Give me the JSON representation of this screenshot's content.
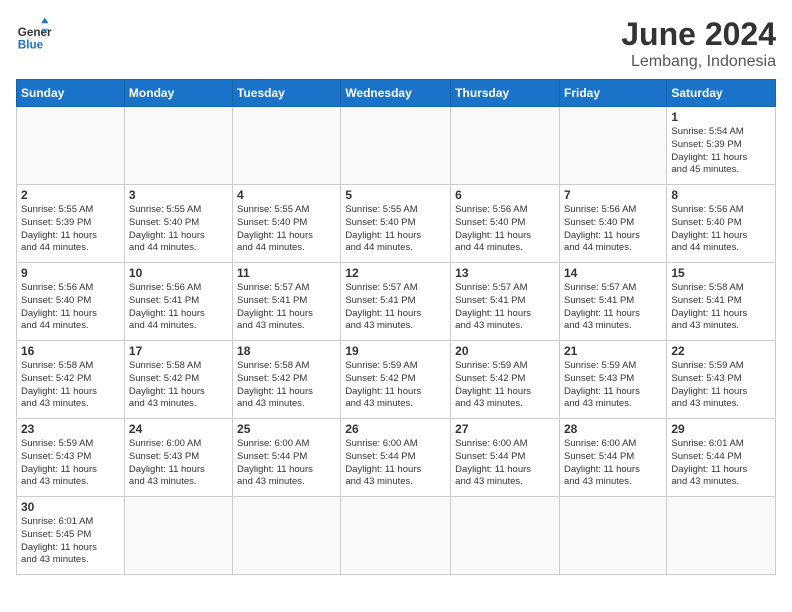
{
  "logo": {
    "text_general": "General",
    "text_blue": "Blue"
  },
  "title": "June 2024",
  "subtitle": "Lembang, Indonesia",
  "days_of_week": [
    "Sunday",
    "Monday",
    "Tuesday",
    "Wednesday",
    "Thursday",
    "Friday",
    "Saturday"
  ],
  "weeks": [
    [
      {
        "day": "",
        "info": ""
      },
      {
        "day": "",
        "info": ""
      },
      {
        "day": "",
        "info": ""
      },
      {
        "day": "",
        "info": ""
      },
      {
        "day": "",
        "info": ""
      },
      {
        "day": "",
        "info": ""
      },
      {
        "day": "1",
        "info": "Sunrise: 5:54 AM\nSunset: 5:39 PM\nDaylight: 11 hours\nand 45 minutes."
      }
    ],
    [
      {
        "day": "2",
        "info": "Sunrise: 5:55 AM\nSunset: 5:39 PM\nDaylight: 11 hours\nand 44 minutes."
      },
      {
        "day": "3",
        "info": "Sunrise: 5:55 AM\nSunset: 5:40 PM\nDaylight: 11 hours\nand 44 minutes."
      },
      {
        "day": "4",
        "info": "Sunrise: 5:55 AM\nSunset: 5:40 PM\nDaylight: 11 hours\nand 44 minutes."
      },
      {
        "day": "5",
        "info": "Sunrise: 5:55 AM\nSunset: 5:40 PM\nDaylight: 11 hours\nand 44 minutes."
      },
      {
        "day": "6",
        "info": "Sunrise: 5:56 AM\nSunset: 5:40 PM\nDaylight: 11 hours\nand 44 minutes."
      },
      {
        "day": "7",
        "info": "Sunrise: 5:56 AM\nSunset: 5:40 PM\nDaylight: 11 hours\nand 44 minutes."
      },
      {
        "day": "8",
        "info": "Sunrise: 5:56 AM\nSunset: 5:40 PM\nDaylight: 11 hours\nand 44 minutes."
      }
    ],
    [
      {
        "day": "9",
        "info": "Sunrise: 5:56 AM\nSunset: 5:40 PM\nDaylight: 11 hours\nand 44 minutes."
      },
      {
        "day": "10",
        "info": "Sunrise: 5:56 AM\nSunset: 5:41 PM\nDaylight: 11 hours\nand 44 minutes."
      },
      {
        "day": "11",
        "info": "Sunrise: 5:57 AM\nSunset: 5:41 PM\nDaylight: 11 hours\nand 43 minutes."
      },
      {
        "day": "12",
        "info": "Sunrise: 5:57 AM\nSunset: 5:41 PM\nDaylight: 11 hours\nand 43 minutes."
      },
      {
        "day": "13",
        "info": "Sunrise: 5:57 AM\nSunset: 5:41 PM\nDaylight: 11 hours\nand 43 minutes."
      },
      {
        "day": "14",
        "info": "Sunrise: 5:57 AM\nSunset: 5:41 PM\nDaylight: 11 hours\nand 43 minutes."
      },
      {
        "day": "15",
        "info": "Sunrise: 5:58 AM\nSunset: 5:41 PM\nDaylight: 11 hours\nand 43 minutes."
      }
    ],
    [
      {
        "day": "16",
        "info": "Sunrise: 5:58 AM\nSunset: 5:42 PM\nDaylight: 11 hours\nand 43 minutes."
      },
      {
        "day": "17",
        "info": "Sunrise: 5:58 AM\nSunset: 5:42 PM\nDaylight: 11 hours\nand 43 minutes."
      },
      {
        "day": "18",
        "info": "Sunrise: 5:58 AM\nSunset: 5:42 PM\nDaylight: 11 hours\nand 43 minutes."
      },
      {
        "day": "19",
        "info": "Sunrise: 5:59 AM\nSunset: 5:42 PM\nDaylight: 11 hours\nand 43 minutes."
      },
      {
        "day": "20",
        "info": "Sunrise: 5:59 AM\nSunset: 5:42 PM\nDaylight: 11 hours\nand 43 minutes."
      },
      {
        "day": "21",
        "info": "Sunrise: 5:59 AM\nSunset: 5:43 PM\nDaylight: 11 hours\nand 43 minutes."
      },
      {
        "day": "22",
        "info": "Sunrise: 5:59 AM\nSunset: 5:43 PM\nDaylight: 11 hours\nand 43 minutes."
      }
    ],
    [
      {
        "day": "23",
        "info": "Sunrise: 5:59 AM\nSunset: 5:43 PM\nDaylight: 11 hours\nand 43 minutes."
      },
      {
        "day": "24",
        "info": "Sunrise: 6:00 AM\nSunset: 5:43 PM\nDaylight: 11 hours\nand 43 minutes."
      },
      {
        "day": "25",
        "info": "Sunrise: 6:00 AM\nSunset: 5:44 PM\nDaylight: 11 hours\nand 43 minutes."
      },
      {
        "day": "26",
        "info": "Sunrise: 6:00 AM\nSunset: 5:44 PM\nDaylight: 11 hours\nand 43 minutes."
      },
      {
        "day": "27",
        "info": "Sunrise: 6:00 AM\nSunset: 5:44 PM\nDaylight: 11 hours\nand 43 minutes."
      },
      {
        "day": "28",
        "info": "Sunrise: 6:00 AM\nSunset: 5:44 PM\nDaylight: 11 hours\nand 43 minutes."
      },
      {
        "day": "29",
        "info": "Sunrise: 6:01 AM\nSunset: 5:44 PM\nDaylight: 11 hours\nand 43 minutes."
      }
    ],
    [
      {
        "day": "30",
        "info": "Sunrise: 6:01 AM\nSunset: 5:45 PM\nDaylight: 11 hours\nand 43 minutes."
      },
      {
        "day": "",
        "info": ""
      },
      {
        "day": "",
        "info": ""
      },
      {
        "day": "",
        "info": ""
      },
      {
        "day": "",
        "info": ""
      },
      {
        "day": "",
        "info": ""
      },
      {
        "day": "",
        "info": ""
      }
    ]
  ]
}
